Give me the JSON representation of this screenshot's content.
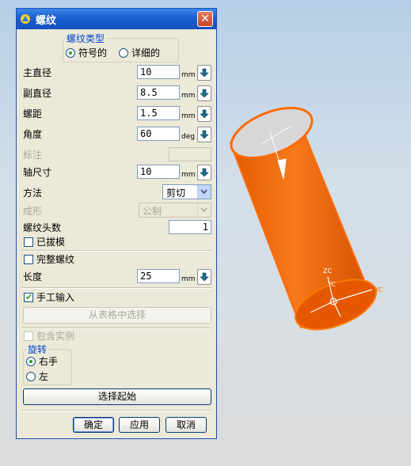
{
  "dialog": {
    "title": "螺纹",
    "close_symbol": "✕",
    "thread_type": {
      "group_title": "螺纹类型",
      "options": [
        "符号的",
        "详细的"
      ],
      "selected": "符号的"
    },
    "fields": {
      "major_diameter": {
        "label": "主直径",
        "value": "10",
        "unit": "mm"
      },
      "minor_diameter": {
        "label": "副直径",
        "value": "8.5",
        "unit": "mm"
      },
      "pitch": {
        "label": "螺距",
        "value": "1.5",
        "unit": "mm"
      },
      "angle": {
        "label": "角度",
        "value": "60",
        "unit": "deg"
      },
      "callout": {
        "label": "标注",
        "value": ""
      },
      "shaft_size": {
        "label": "轴尺寸",
        "value": "10",
        "unit": "mm"
      },
      "method": {
        "label": "方法",
        "value": "剪切"
      },
      "form": {
        "label": "成形",
        "value": "公制"
      },
      "num_starts": {
        "label": "螺纹头数",
        "value": "1"
      },
      "length": {
        "label": "长度",
        "value": "25",
        "unit": "mm"
      }
    },
    "checkboxes": {
      "tapered": {
        "label": "已拔模",
        "checked": false
      },
      "full_thread": {
        "label": "完整螺纹",
        "checked": false
      },
      "manual_input": {
        "label": "手工输入",
        "checked": true
      },
      "include_instances": {
        "label": "包含实例",
        "checked": false
      }
    },
    "choose_from_table": "从表格中选择",
    "rotation": {
      "group_title": "旋转",
      "options": [
        "右手",
        "左"
      ],
      "selected": "右手"
    },
    "select_start": "选择起始",
    "buttons": {
      "ok": "确定",
      "apply": "应用",
      "cancel": "取消"
    }
  },
  "viewport": {
    "labels": {
      "zc": "ZC",
      "yc": "YC",
      "xc": "XC"
    },
    "cylinder_color": "#f26500",
    "axis_color": "#ffffff"
  },
  "colors": {
    "title_bar": "#1b5fd0",
    "dialog_bg": "#ece9d8",
    "group_title": "#0046d5",
    "check_tick": "#21a121"
  }
}
